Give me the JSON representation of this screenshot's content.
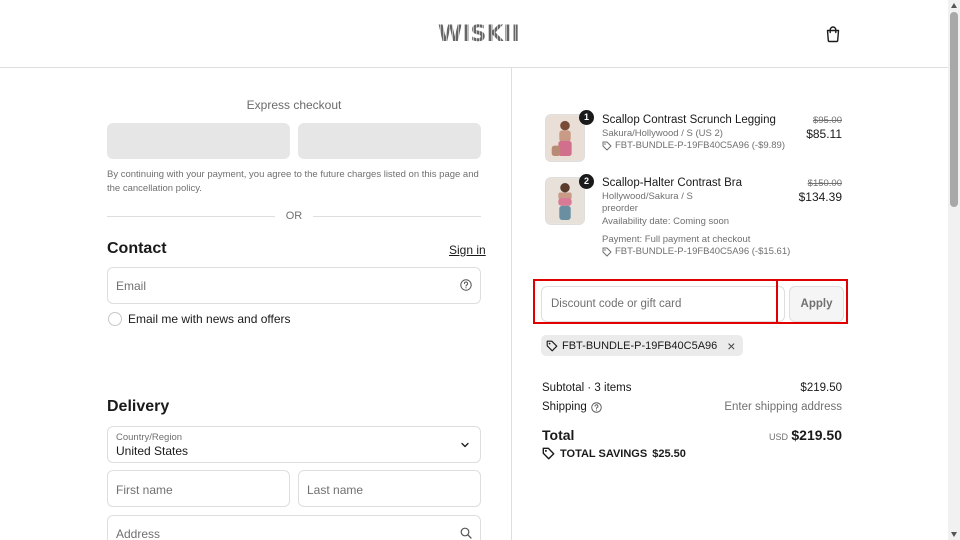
{
  "header": {
    "logo_text": "WISKII",
    "cart_icon": "shopping-bag-icon"
  },
  "express": {
    "title": "Express checkout",
    "consent_text": "By continuing with your payment, you agree to the future charges listed on this page and the cancellation policy.",
    "or_text": "OR"
  },
  "contact": {
    "title": "Contact",
    "signin_label": "Sign in",
    "email_placeholder": "Email",
    "newsletter_label": "Email me with news and offers"
  },
  "delivery": {
    "title": "Delivery",
    "country_label": "Country/Region",
    "country_value": "United States",
    "first_name_placeholder": "First name",
    "last_name_placeholder": "Last name",
    "address_placeholder": "Address"
  },
  "items": [
    {
      "qty": "1",
      "name": "Scallop Contrast Scrunch Legging",
      "variant": "Sakura/Hollywood / S (US 2)",
      "discount": "FBT-BUNDLE-P-19FB40C5A96 (-$9.89)",
      "price_old": "$95.00",
      "price_new": "$85.11"
    },
    {
      "qty": "2",
      "name": "Scallop-Halter Contrast Bra",
      "variant": "Hollywood/Sakura / S",
      "preorder": "preorder",
      "availability": "Availability date: Coming soon",
      "payment": "Payment: Full payment at checkout",
      "discount": "FBT-BUNDLE-P-19FB40C5A96 (-$15.61)",
      "price_old": "$150.00",
      "price_new": "$134.39"
    }
  ],
  "discount": {
    "placeholder": "Discount code or gift card",
    "apply_label": "Apply",
    "applied_code": "FBT-BUNDLE-P-19FB40C5A96"
  },
  "summary": {
    "subtotal_label": "Subtotal · 3 items",
    "subtotal_value": "$219.50",
    "shipping_label": "Shipping",
    "shipping_value": "Enter shipping address",
    "total_label": "Total",
    "currency": "USD",
    "total_value": "$219.50",
    "savings_label": "TOTAL SAVINGS",
    "savings_value": "$25.50"
  },
  "colors": {
    "highlight": "#e00000",
    "express_button": "#e6e6e6",
    "border": "#dedede"
  }
}
